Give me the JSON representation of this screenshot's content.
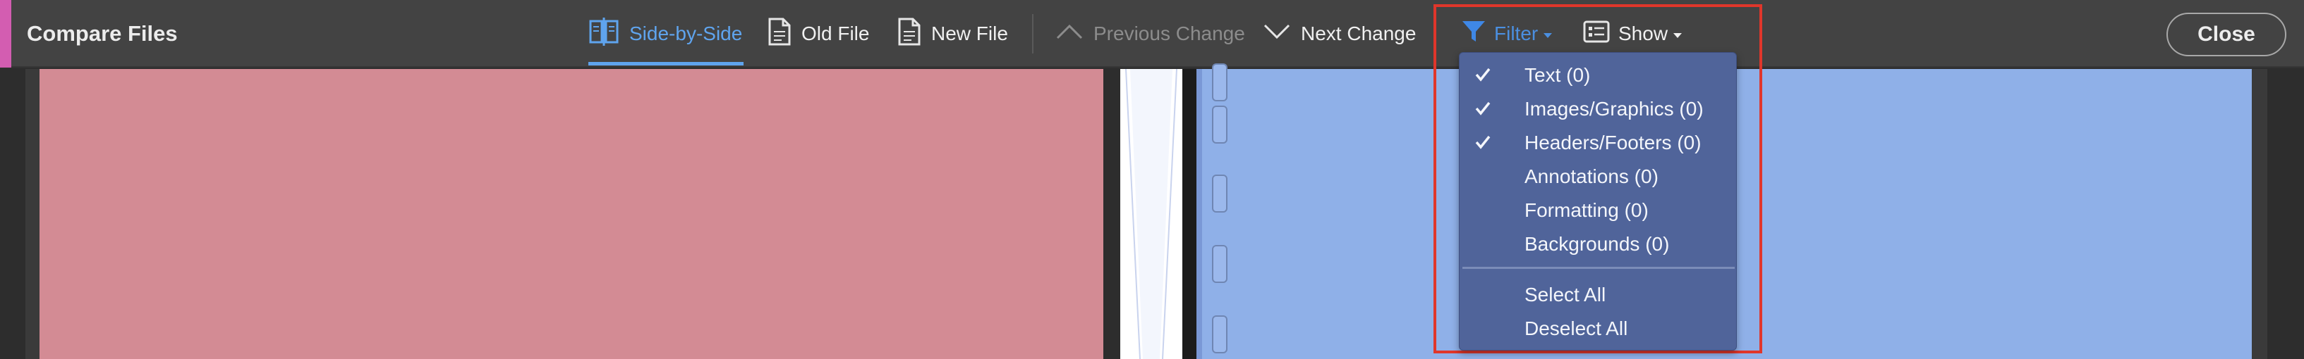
{
  "window": {
    "title": "Compare Files"
  },
  "toolbar": {
    "side_by_side": "Side-by-Side",
    "old_file": "Old File",
    "new_file": "New File",
    "previous_change": "Previous Change",
    "next_change": "Next Change",
    "filter": "Filter",
    "show": "Show",
    "close": "Close"
  },
  "filter_menu": {
    "items": [
      {
        "label": "Text (0)",
        "checked": true
      },
      {
        "label": "Images/Graphics (0)",
        "checked": true
      },
      {
        "label": "Headers/Footers (0)",
        "checked": true
      },
      {
        "label": "Annotations (0)",
        "checked": false
      },
      {
        "label": "Formatting (0)",
        "checked": false
      },
      {
        "label": "Backgrounds (0)",
        "checked": false
      }
    ],
    "select_all": "Select All",
    "deselect_all": "Deselect All"
  },
  "colors": {
    "accent": "#5fa4ee",
    "old_pane": "#d38b94",
    "new_pane": "#8fb0e8",
    "highlight": "#e0362b",
    "menu_bg": "#50649a"
  }
}
